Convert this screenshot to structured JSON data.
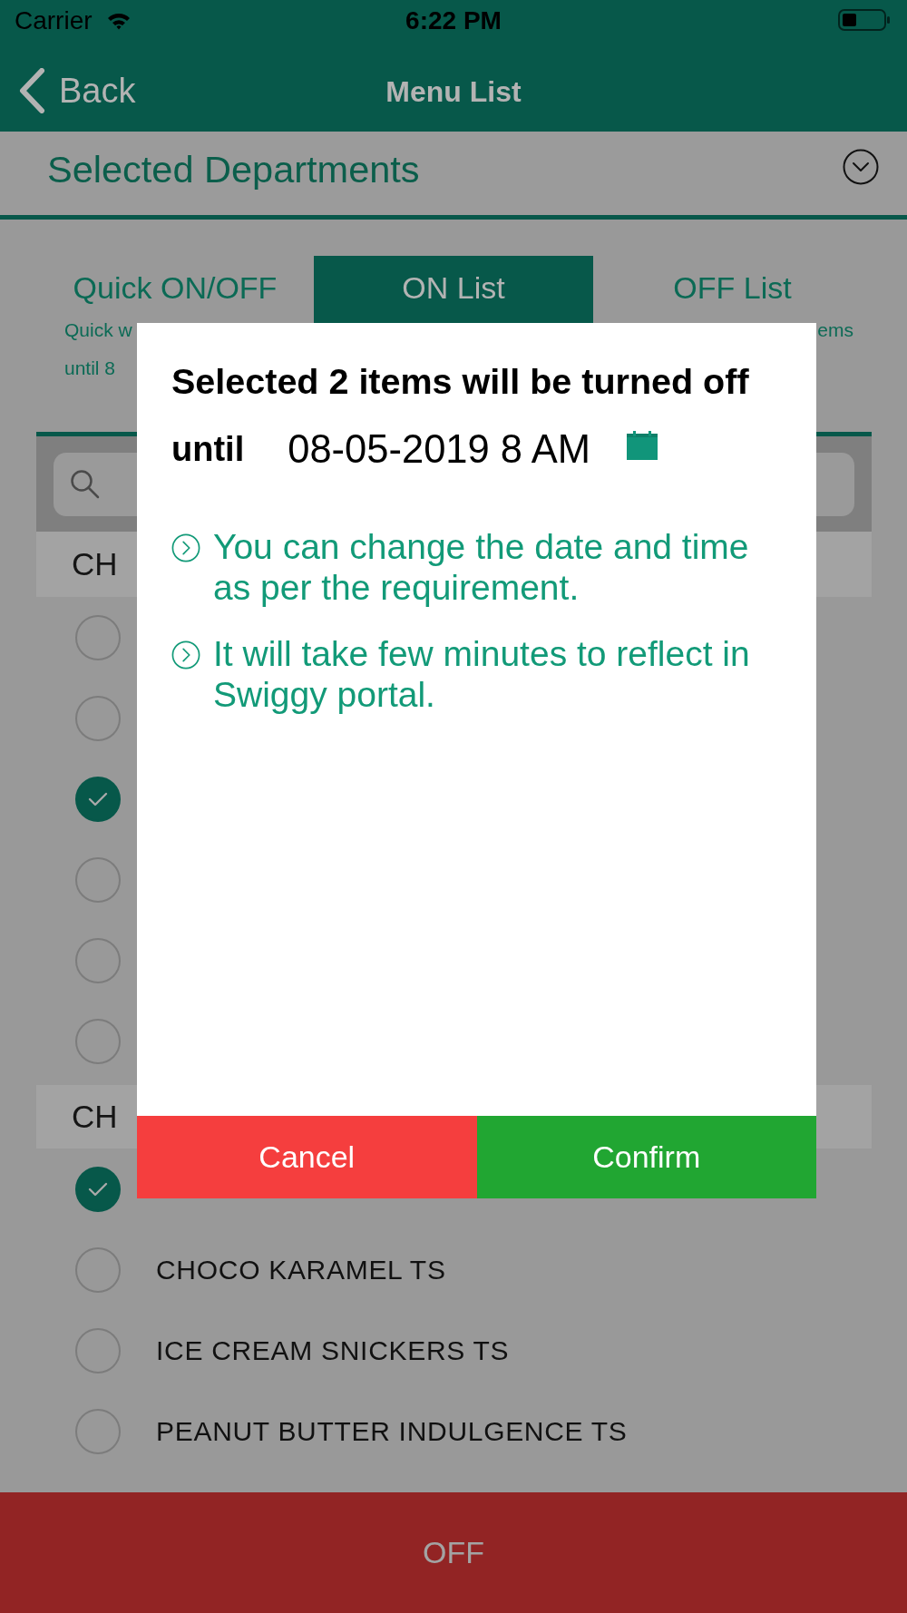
{
  "status_bar": {
    "carrier": "Carrier",
    "time": "6:22 PM"
  },
  "nav_bar": {
    "back": "Back",
    "title": "Menu List"
  },
  "department_picker": {
    "label": "Selected Departments"
  },
  "tabs": [
    {
      "label": "Quick ON/OFF",
      "selected": false,
      "subtitle_lines": [
        "Quick w",
        "until 8"
      ]
    },
    {
      "label": "ON List",
      "selected": true
    },
    {
      "label": "OFF List",
      "selected": false,
      "subtitle_lines": [
        "ems"
      ]
    }
  ],
  "sections": [
    {
      "title": "CH",
      "items": [
        {
          "checked": false
        },
        {
          "checked": false
        },
        {
          "checked": true
        },
        {
          "checked": false
        },
        {
          "checked": false
        },
        {
          "checked": false
        }
      ]
    },
    {
      "title": "CH",
      "items": [
        {
          "checked": true
        },
        {
          "name": "CHOCO KARAMEL TS",
          "checked": false
        },
        {
          "name": "ICE CREAM SNICKERS TS",
          "checked": false
        },
        {
          "name": "PEANUT BUTTER INDULGENCE TS",
          "checked": false
        }
      ]
    }
  ],
  "dialog": {
    "title": "Selected 2 items will be turned off",
    "until_label": "until",
    "date": "08-05-2019 8 AM",
    "notes": [
      "You can change the date and time as per the requirement.",
      "It will take few minutes to reflect in Swiggy portal."
    ],
    "buttons": [
      {
        "label": "Cancel",
        "kind": "cancel"
      },
      {
        "label": "Confirm",
        "kind": "confirm"
      }
    ]
  },
  "bottom_bar": {
    "button": "OFF"
  }
}
